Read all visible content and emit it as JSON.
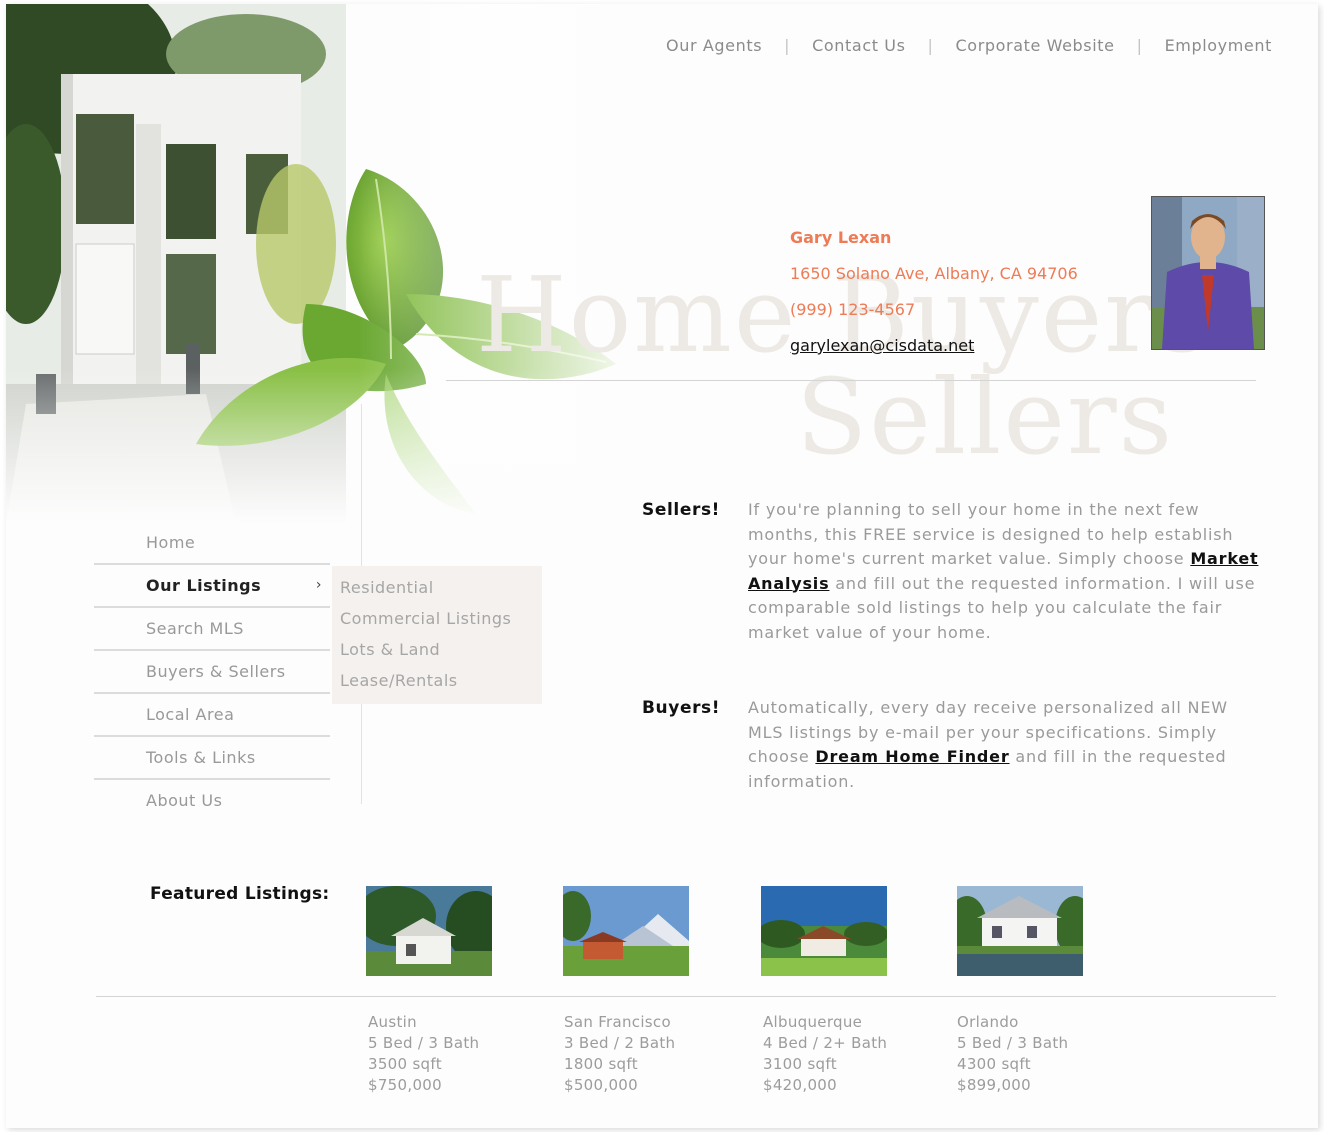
{
  "top_nav": [
    {
      "label": "Our Agents"
    },
    {
      "label": "Contact Us"
    },
    {
      "label": "Corporate Website"
    },
    {
      "label": "Employment"
    }
  ],
  "top_nav_separator": "|",
  "watermark": {
    "line1": "Home Buyers",
    "line2": "Sellers"
  },
  "agent": {
    "name": "Gary Lexan",
    "address": "1650 Solano Ave, Albany, CA 94706",
    "phone": "(999) 123-4567",
    "email": "garylexan@cisdata.net"
  },
  "left_nav": {
    "items": [
      {
        "label": "Home"
      },
      {
        "label": "Our Listings",
        "chevron": "›"
      },
      {
        "label": "Search MLS"
      },
      {
        "label": "Buyers & Sellers"
      },
      {
        "label": "Local Area"
      },
      {
        "label": "Tools & Links"
      },
      {
        "label": "About Us"
      }
    ],
    "active": "Our Listings",
    "submenu": [
      "Residential",
      "Commercial Listings",
      "Lots & Land",
      "Lease/Rentals"
    ]
  },
  "sellers": {
    "label": "Sellers!",
    "text_before": "If you're planning to sell your home in the next few months, this FREE service is designed to help establish your home's current market value. Simply choose ",
    "link": "Market Analysis",
    "text_after": " and fill out the requested information. I will use comparable sold listings to help you calculate the fair market value of your home."
  },
  "buyers": {
    "label": "Buyers!",
    "text_before": "Automatically, every day receive personalized all NEW MLS listings by e-mail per your specifications. Simply choose ",
    "link": "Dream Home Finder",
    "text_after": " and fill in the requested information."
  },
  "featured": {
    "title": "Featured Listings:",
    "listings": [
      {
        "city": "Austin",
        "beds_baths": "5 Bed / 3 Bath",
        "sqft": "3500 sqft",
        "price": "$750,000"
      },
      {
        "city": "San Francisco",
        "beds_baths": "3 Bed / 2 Bath",
        "sqft": "1800 sqft",
        "price": "$500,000"
      },
      {
        "city": "Albuquerque",
        "beds_baths": "4 Bed / 2+ Bath",
        "sqft": "3100 sqft",
        "price": "$420,000"
      },
      {
        "city": "Orlando",
        "beds_baths": "5 Bed / 3 Bath",
        "sqft": "4300 sqft",
        "price": "$899,000"
      }
    ]
  },
  "colors": {
    "accent": "#ee7b55",
    "leaf": "#6aa832",
    "muted_text": "#9a9a9a",
    "submenu_bg": "#f5f1ee"
  }
}
